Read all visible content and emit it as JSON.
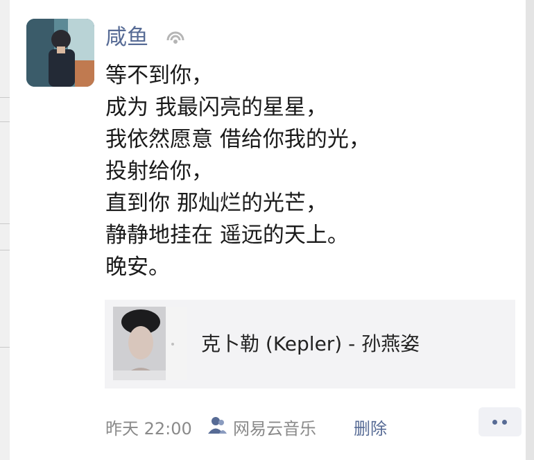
{
  "post": {
    "author": "咸鱼",
    "lines": [
      "等不到你，",
      "成为 我最闪亮的星星，",
      "我依然愿意 借给你我的光，",
      "投射给你，",
      "直到你 那灿烂的光芒，",
      "静静地挂在 遥远的天上。",
      "晚安。"
    ],
    "share": {
      "title": "克卜勒 (Kepler) - 孙燕姿"
    },
    "footer": {
      "time": "昨天 22:00",
      "source": "网易云音乐",
      "delete_label": "删除"
    }
  },
  "colors": {
    "link": "#576b95",
    "meta": "#8a8a8a",
    "share_bg": "#f3f3f5"
  },
  "icons": {
    "verify": "signal-waves-icon",
    "visibility": "people-icon",
    "more": "more-dots-icon"
  }
}
